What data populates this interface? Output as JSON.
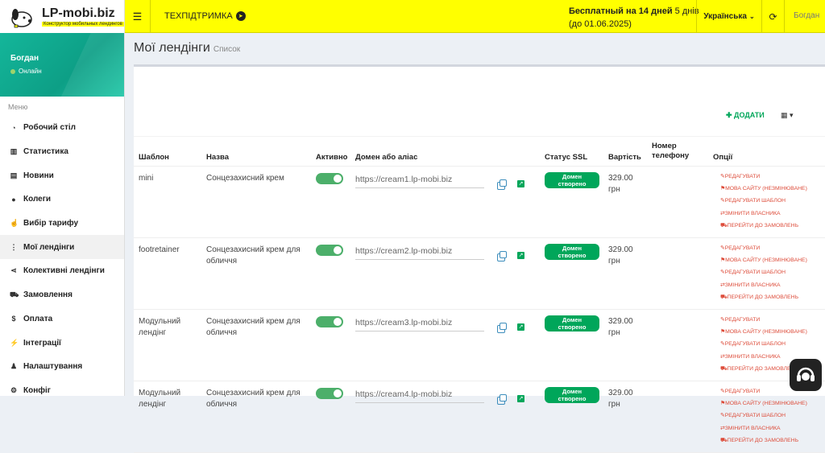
{
  "header": {
    "brand": "LP-mobi.biz",
    "tagline": "Конструктор мобильных лендингов",
    "support": "ТЕХПІДТРИМКА",
    "trial_bold": "Бесплатный на 14 дней",
    "trial_days": "5 днів",
    "trial_until": "(до 01.06.2025)",
    "language": "Українська",
    "user": "Богдан"
  },
  "sidebar": {
    "user_name": "Богдан",
    "status": "Онлайн",
    "menu_header": "Меню",
    "items": [
      {
        "label": "Робочий стіл",
        "icon": "dashboard-icon"
      },
      {
        "label": "Статистика",
        "icon": "bar-chart-icon"
      },
      {
        "label": "Новини",
        "icon": "newspaper-icon"
      },
      {
        "label": "Колеги",
        "icon": "users-icon"
      },
      {
        "label": "Вибір тарифу",
        "icon": "hand-pointer-icon"
      },
      {
        "label": "Мої лендінги",
        "icon": "sitemap-icon"
      },
      {
        "label": "Колективні лендінги",
        "icon": "share-icon"
      },
      {
        "label": "Замовлення",
        "icon": "cart-icon"
      },
      {
        "label": "Оплата",
        "icon": "dollar-icon"
      },
      {
        "label": "Інтеграції",
        "icon": "plug-icon"
      },
      {
        "label": "Налаштування",
        "icon": "user-icon"
      },
      {
        "label": "Конфіг",
        "icon": "gears-icon"
      }
    ]
  },
  "page": {
    "title": "Мої лендінги",
    "subtitle": "Список",
    "add_label": "ДОДАТИ"
  },
  "table": {
    "headers": {
      "template": "Шаблон",
      "name": "Назва",
      "active": "Активно",
      "domain": "Домен або аліас",
      "ssl": "Статус SSL",
      "price": "Вартість",
      "phone_1": "Номер",
      "phone_2": "телефону",
      "options": "Опції"
    },
    "rows": [
      {
        "template": "mini",
        "template2": "",
        "name": "Сонцезахисний крем",
        "name2": "",
        "domain": "https://cream1.lp-mobi.biz",
        "ssl1": "Домен",
        "ssl2": "створено",
        "price1": "329.00",
        "price2": "грн"
      },
      {
        "template": "footretainer",
        "template2": "",
        "name": "Сонцезахисний крем для",
        "name2": "обличчя",
        "domain": "https://cream2.lp-mobi.biz",
        "ssl1": "Домен",
        "ssl2": "створено",
        "price1": "329.00",
        "price2": "грн"
      },
      {
        "template": "Модульний",
        "template2": "лендінг",
        "name": "Сонцезахисний крем для",
        "name2": "обличчя",
        "domain": "https://cream3.lp-mobi.biz",
        "ssl1": "Домен",
        "ssl2": "створено",
        "price1": "329.00",
        "price2": "грн"
      },
      {
        "template": "Модульний",
        "template2": "лендінг",
        "name": "Сонцезахисний крем для",
        "name2": "обличчя",
        "domain": "https://cream4.lp-mobi.biz",
        "ssl1": "Домен",
        "ssl2": "створено",
        "price1": "329.00",
        "price2": "грн"
      }
    ],
    "options": {
      "edit": "РЕДАГУВАТИ",
      "lang": "МОВА САЙТУ (НЕЗМІНЮВАНЕ)",
      "edit_template": "РЕДАГУВАТИ ШАБЛОН",
      "change_owner": "ЗМІНИТИ ВЛАСНИКА",
      "orders": "ПЕРЕЙТИ ДО ЗАМОВЛЕНЬ"
    }
  },
  "colors": {
    "topbar": "#ffff00",
    "accent_green": "#00a65a",
    "option_red": "#dd4b39",
    "sidebar_teal": "#14b69a"
  }
}
